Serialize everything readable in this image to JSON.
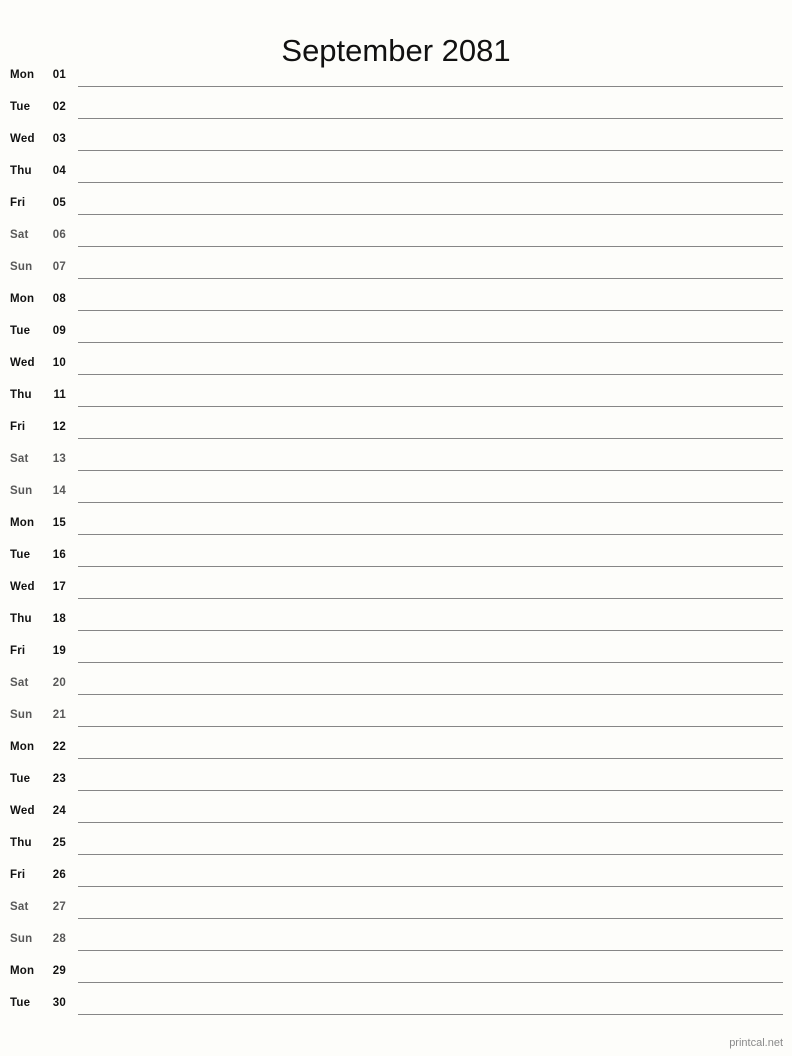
{
  "title": "September 2081",
  "footer": "printcal.net",
  "colors": {
    "background": "#fdfdfa",
    "text": "#111111",
    "weekend_text": "#585858",
    "rule_line": "#868686",
    "footer_text": "#8a8a8a"
  },
  "days": [
    {
      "weekday": "Mon",
      "date": "01",
      "weekend": false
    },
    {
      "weekday": "Tue",
      "date": "02",
      "weekend": false
    },
    {
      "weekday": "Wed",
      "date": "03",
      "weekend": false
    },
    {
      "weekday": "Thu",
      "date": "04",
      "weekend": false
    },
    {
      "weekday": "Fri",
      "date": "05",
      "weekend": false
    },
    {
      "weekday": "Sat",
      "date": "06",
      "weekend": true
    },
    {
      "weekday": "Sun",
      "date": "07",
      "weekend": true
    },
    {
      "weekday": "Mon",
      "date": "08",
      "weekend": false
    },
    {
      "weekday": "Tue",
      "date": "09",
      "weekend": false
    },
    {
      "weekday": "Wed",
      "date": "10",
      "weekend": false
    },
    {
      "weekday": "Thu",
      "date": "11",
      "weekend": false
    },
    {
      "weekday": "Fri",
      "date": "12",
      "weekend": false
    },
    {
      "weekday": "Sat",
      "date": "13",
      "weekend": true
    },
    {
      "weekday": "Sun",
      "date": "14",
      "weekend": true
    },
    {
      "weekday": "Mon",
      "date": "15",
      "weekend": false
    },
    {
      "weekday": "Tue",
      "date": "16",
      "weekend": false
    },
    {
      "weekday": "Wed",
      "date": "17",
      "weekend": false
    },
    {
      "weekday": "Thu",
      "date": "18",
      "weekend": false
    },
    {
      "weekday": "Fri",
      "date": "19",
      "weekend": false
    },
    {
      "weekday": "Sat",
      "date": "20",
      "weekend": true
    },
    {
      "weekday": "Sun",
      "date": "21",
      "weekend": true
    },
    {
      "weekday": "Mon",
      "date": "22",
      "weekend": false
    },
    {
      "weekday": "Tue",
      "date": "23",
      "weekend": false
    },
    {
      "weekday": "Wed",
      "date": "24",
      "weekend": false
    },
    {
      "weekday": "Thu",
      "date": "25",
      "weekend": false
    },
    {
      "weekday": "Fri",
      "date": "26",
      "weekend": false
    },
    {
      "weekday": "Sat",
      "date": "27",
      "weekend": true
    },
    {
      "weekday": "Sun",
      "date": "28",
      "weekend": true
    },
    {
      "weekday": "Mon",
      "date": "29",
      "weekend": false
    },
    {
      "weekday": "Tue",
      "date": "30",
      "weekend": false
    }
  ]
}
